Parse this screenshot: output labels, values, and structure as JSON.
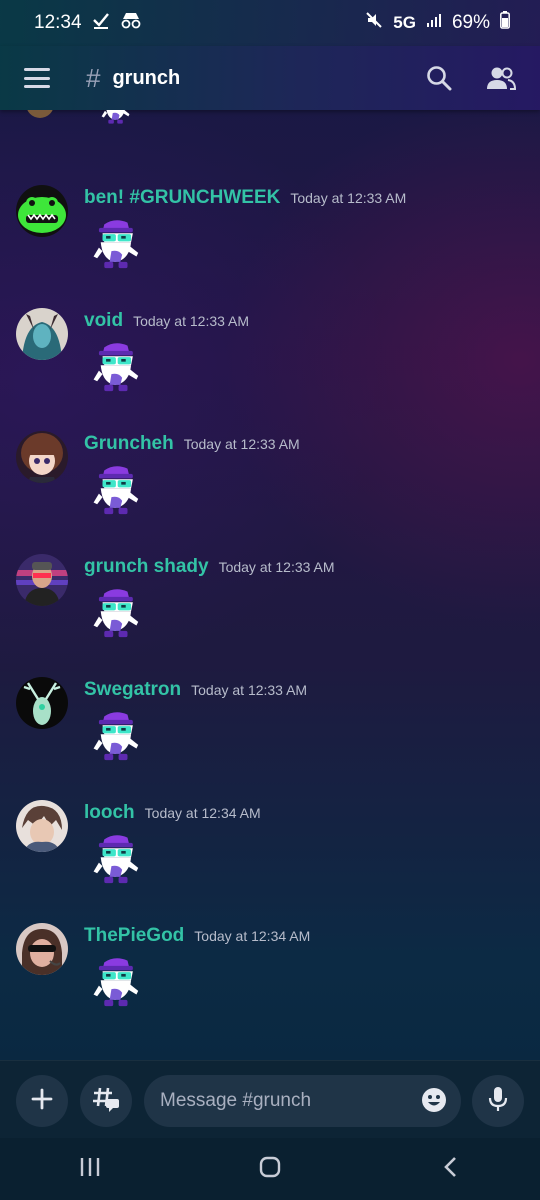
{
  "status_bar": {
    "time": "12:34",
    "network": "5G",
    "battery": "69%"
  },
  "header": {
    "hash_symbol": "#",
    "channel": "grunch",
    "icons": [
      "menu-icon",
      "search-icon",
      "members-icon"
    ]
  },
  "messages": [
    {
      "username": "ben! #GRUNCHWEEK",
      "timestamp": "Today at 12:33 AM"
    },
    {
      "username": "void",
      "timestamp": "Today at 12:33 AM"
    },
    {
      "username": "Gruncheh",
      "timestamp": "Today at 12:33 AM"
    },
    {
      "username": "grunch shady",
      "timestamp": "Today at 12:33 AM"
    },
    {
      "username": "Swegatron",
      "timestamp": "Today at 12:33 AM"
    },
    {
      "username": "looch",
      "timestamp": "Today at 12:34 AM"
    },
    {
      "username": "ThePieGod",
      "timestamp": "Today at 12:34 AM"
    }
  ],
  "composer": {
    "placeholder": "Message #grunch",
    "icons": [
      "plus-icon",
      "threads-icon",
      "emoji-icon",
      "microphone-icon"
    ]
  },
  "colors": {
    "username": "#33c3a6",
    "timestamp": "#b7bccb",
    "composer_bg": "#0d2435"
  }
}
